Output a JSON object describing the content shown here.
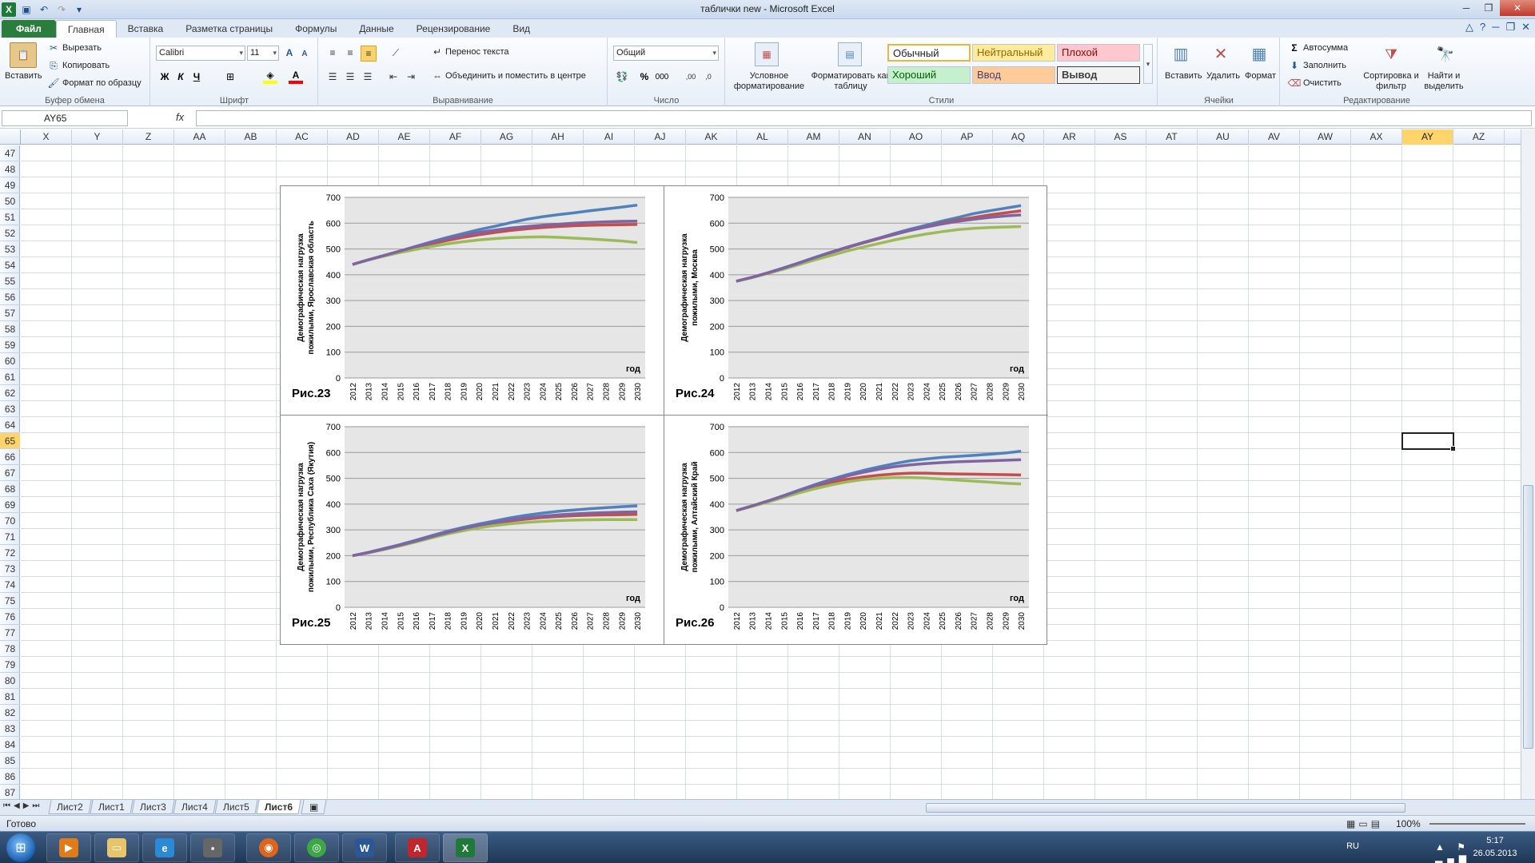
{
  "window": {
    "title": "таблички new - Microsoft Excel"
  },
  "tabs": [
    {
      "label": "Файл"
    },
    {
      "label": "Главная"
    },
    {
      "label": "Вставка"
    },
    {
      "label": "Разметка страницы"
    },
    {
      "label": "Формулы"
    },
    {
      "label": "Данные"
    },
    {
      "label": "Рецензирование"
    },
    {
      "label": "Вид"
    }
  ],
  "ribbon": {
    "clipboard": {
      "paste": "Вставить",
      "cut": "Вырезать",
      "copy": "Копировать",
      "format_painter": "Формат по образцу",
      "label": "Буфер обмена"
    },
    "font": {
      "name": "Calibri",
      "size": "11",
      "label": "Шрифт",
      "bold": "Ж",
      "italic": "К",
      "underline": "Ч"
    },
    "alignment": {
      "wrap": "Перенос текста",
      "merge": "Объединить и поместить в центре",
      "label": "Выравнивание"
    },
    "number": {
      "format": "Общий",
      "label": "Число",
      "percent": "%",
      "thousands": "000"
    },
    "styles": {
      "conditional": "Условное форматирование",
      "as_table": "Форматировать как таблицу",
      "label": "Стили",
      "items": [
        {
          "label": "Обычный",
          "bg": "#ffffff",
          "fg": "#000000"
        },
        {
          "label": "Нейтральный",
          "bg": "#ffeb9c",
          "fg": "#9c6500"
        },
        {
          "label": "Плохой",
          "bg": "#ffc7ce",
          "fg": "#9c0006"
        },
        {
          "label": "Хороший",
          "bg": "#c6efce",
          "fg": "#006100"
        },
        {
          "label": "Ввод",
          "bg": "#ffcc99",
          "fg": "#3f3f76"
        },
        {
          "label": "Вывод",
          "bg": "#f2f2f2",
          "fg": "#3f3f3f"
        }
      ]
    },
    "cells": {
      "insert": "Вставить",
      "delete": "Удалить",
      "format": "Формат",
      "label": "Ячейки"
    },
    "editing": {
      "autosum": "Автосумма",
      "fill": "Заполнить",
      "clear": "Очистить",
      "sort": "Сортировка и фильтр",
      "find": "Найти и выделить",
      "label": "Редактирование"
    }
  },
  "formula_bar": {
    "name_box": "AY65",
    "fx": "fx"
  },
  "grid": {
    "columns": [
      "X",
      "Y",
      "Z",
      "AA",
      "AB",
      "AC",
      "AD",
      "AE",
      "AF",
      "AG",
      "AH",
      "AI",
      "AJ",
      "AK",
      "AL",
      "AM",
      "AN",
      "AO",
      "AP",
      "AQ",
      "AR",
      "AS",
      "AT",
      "AU",
      "AV",
      "AW",
      "AX",
      "AY",
      "AZ"
    ],
    "selected_column": "AY",
    "rows": [
      47,
      48,
      49,
      50,
      51,
      52,
      53,
      54,
      55,
      56,
      57,
      58,
      59,
      60,
      61,
      62,
      63,
      64,
      65,
      66,
      67,
      68,
      69,
      70,
      71,
      72,
      73,
      74,
      75,
      76,
      77,
      78,
      79,
      80,
      81,
      82,
      83,
      84,
      85,
      86,
      87
    ],
    "selected_row": 65
  },
  "sheets": [
    "Лист2",
    "Лист1",
    "Лист3",
    "Лист4",
    "Лист5",
    "Лист6"
  ],
  "active_sheet": "Лист6",
  "status": {
    "ready": "Готово",
    "zoom": "100%"
  },
  "taskbar": {
    "lang": "RU",
    "time": "5:17",
    "date": "26.05.2013"
  },
  "chart_data": [
    {
      "type": "line",
      "title": "Рис.23",
      "ylabel": "Демографическая нагрузка пожилыми, Ярославская область",
      "xlabel": "год",
      "ylim": [
        0,
        700
      ],
      "x": [
        2012,
        2013,
        2014,
        2015,
        2016,
        2017,
        2018,
        2019,
        2020,
        2021,
        2022,
        2023,
        2024,
        2025,
        2026,
        2027,
        2028,
        2029,
        2030
      ],
      "series": [
        {
          "color": "#4f81bd",
          "values": [
            440,
            458,
            475,
            492,
            510,
            528,
            545,
            560,
            575,
            588,
            602,
            615,
            625,
            633,
            640,
            648,
            655,
            662,
            670
          ]
        },
        {
          "color": "#c0504d",
          "values": [
            440,
            458,
            474,
            490,
            506,
            520,
            533,
            545,
            555,
            564,
            572,
            578,
            583,
            587,
            590,
            592,
            593,
            594,
            595
          ]
        },
        {
          "color": "#9bbb59",
          "values": [
            440,
            457,
            472,
            486,
            498,
            510,
            520,
            528,
            535,
            540,
            544,
            546,
            547,
            545,
            542,
            539,
            535,
            531,
            525
          ]
        },
        {
          "color": "#8064a2",
          "values": [
            440,
            458,
            475,
            492,
            509,
            525,
            540,
            553,
            564,
            573,
            581,
            587,
            592,
            596,
            600,
            603,
            605,
            607,
            608
          ]
        }
      ]
    },
    {
      "type": "line",
      "title": "Рис.24",
      "ylabel": "Демографическая нагрузка пожилыми, Москва",
      "xlabel": "год",
      "ylim": [
        0,
        700
      ],
      "x": [
        2012,
        2013,
        2014,
        2015,
        2016,
        2017,
        2018,
        2019,
        2020,
        2021,
        2022,
        2023,
        2024,
        2025,
        2026,
        2027,
        2028,
        2029,
        2030
      ],
      "series": [
        {
          "color": "#4f81bd",
          "values": [
            375,
            390,
            408,
            427,
            447,
            468,
            488,
            507,
            525,
            542,
            560,
            577,
            592,
            608,
            622,
            637,
            648,
            658,
            668
          ]
        },
        {
          "color": "#c0504d",
          "values": [
            375,
            390,
            407,
            425,
            445,
            466,
            486,
            505,
            523,
            540,
            556,
            572,
            586,
            600,
            612,
            622,
            632,
            640,
            648
          ]
        },
        {
          "color": "#9bbb59",
          "values": [
            375,
            389,
            405,
            422,
            440,
            458,
            475,
            492,
            507,
            521,
            535,
            547,
            558,
            567,
            575,
            580,
            583,
            585,
            587
          ]
        },
        {
          "color": "#8064a2",
          "values": [
            375,
            390,
            407,
            426,
            446,
            467,
            487,
            506,
            524,
            541,
            557,
            572,
            585,
            597,
            607,
            615,
            622,
            628,
            632
          ]
        }
      ]
    },
    {
      "type": "line",
      "title": "Рис.25",
      "ylabel": "Демографическая нагрузка пожилыми, Республика Саха (Якутия)",
      "xlabel": "год",
      "ylim": [
        0,
        700
      ],
      "x": [
        2012,
        2013,
        2014,
        2015,
        2016,
        2017,
        2018,
        2019,
        2020,
        2021,
        2022,
        2023,
        2024,
        2025,
        2026,
        2027,
        2028,
        2029,
        2030
      ],
      "series": [
        {
          "color": "#4f81bd",
          "values": [
            200,
            213,
            228,
            243,
            260,
            278,
            295,
            310,
            323,
            335,
            347,
            357,
            365,
            372,
            377,
            382,
            386,
            390,
            393
          ]
        },
        {
          "color": "#c0504d",
          "values": [
            200,
            212,
            226,
            241,
            257,
            274,
            290,
            304,
            316,
            326,
            335,
            342,
            348,
            352,
            355,
            357,
            358,
            359,
            360
          ]
        },
        {
          "color": "#9bbb59",
          "values": [
            200,
            211,
            224,
            238,
            253,
            269,
            284,
            297,
            308,
            317,
            324,
            329,
            333,
            336,
            338,
            339,
            340,
            340,
            340
          ]
        },
        {
          "color": "#8064a2",
          "values": [
            200,
            212,
            226,
            241,
            257,
            274,
            290,
            305,
            318,
            329,
            339,
            347,
            353,
            358,
            362,
            365,
            367,
            369,
            370
          ]
        }
      ]
    },
    {
      "type": "line",
      "title": "Рис.26",
      "ylabel": "Демографическая нагрузка пожилыми, Алтайский Край",
      "xlabel": "год",
      "ylim": [
        0,
        700
      ],
      "x": [
        2012,
        2013,
        2014,
        2015,
        2016,
        2017,
        2018,
        2019,
        2020,
        2021,
        2022,
        2023,
        2024,
        2025,
        2026,
        2027,
        2028,
        2029,
        2030
      ],
      "series": [
        {
          "color": "#4f81bd",
          "values": [
            375,
            393,
            412,
            433,
            455,
            476,
            496,
            514,
            530,
            544,
            557,
            568,
            575,
            581,
            585,
            589,
            593,
            598,
            605
          ]
        },
        {
          "color": "#c0504d",
          "values": [
            375,
            392,
            410,
            430,
            450,
            468,
            484,
            496,
            505,
            512,
            517,
            520,
            520,
            518,
            517,
            516,
            515,
            514,
            513
          ]
        },
        {
          "color": "#9bbb59",
          "values": [
            375,
            391,
            408,
            426,
            444,
            460,
            474,
            486,
            495,
            500,
            503,
            503,
            501,
            497,
            493,
            489,
            485,
            481,
            478
          ]
        },
        {
          "color": "#8064a2",
          "values": [
            375,
            393,
            412,
            432,
            453,
            473,
            492,
            509,
            523,
            535,
            545,
            552,
            557,
            561,
            564,
            566,
            568,
            570,
            572
          ]
        }
      ]
    }
  ]
}
